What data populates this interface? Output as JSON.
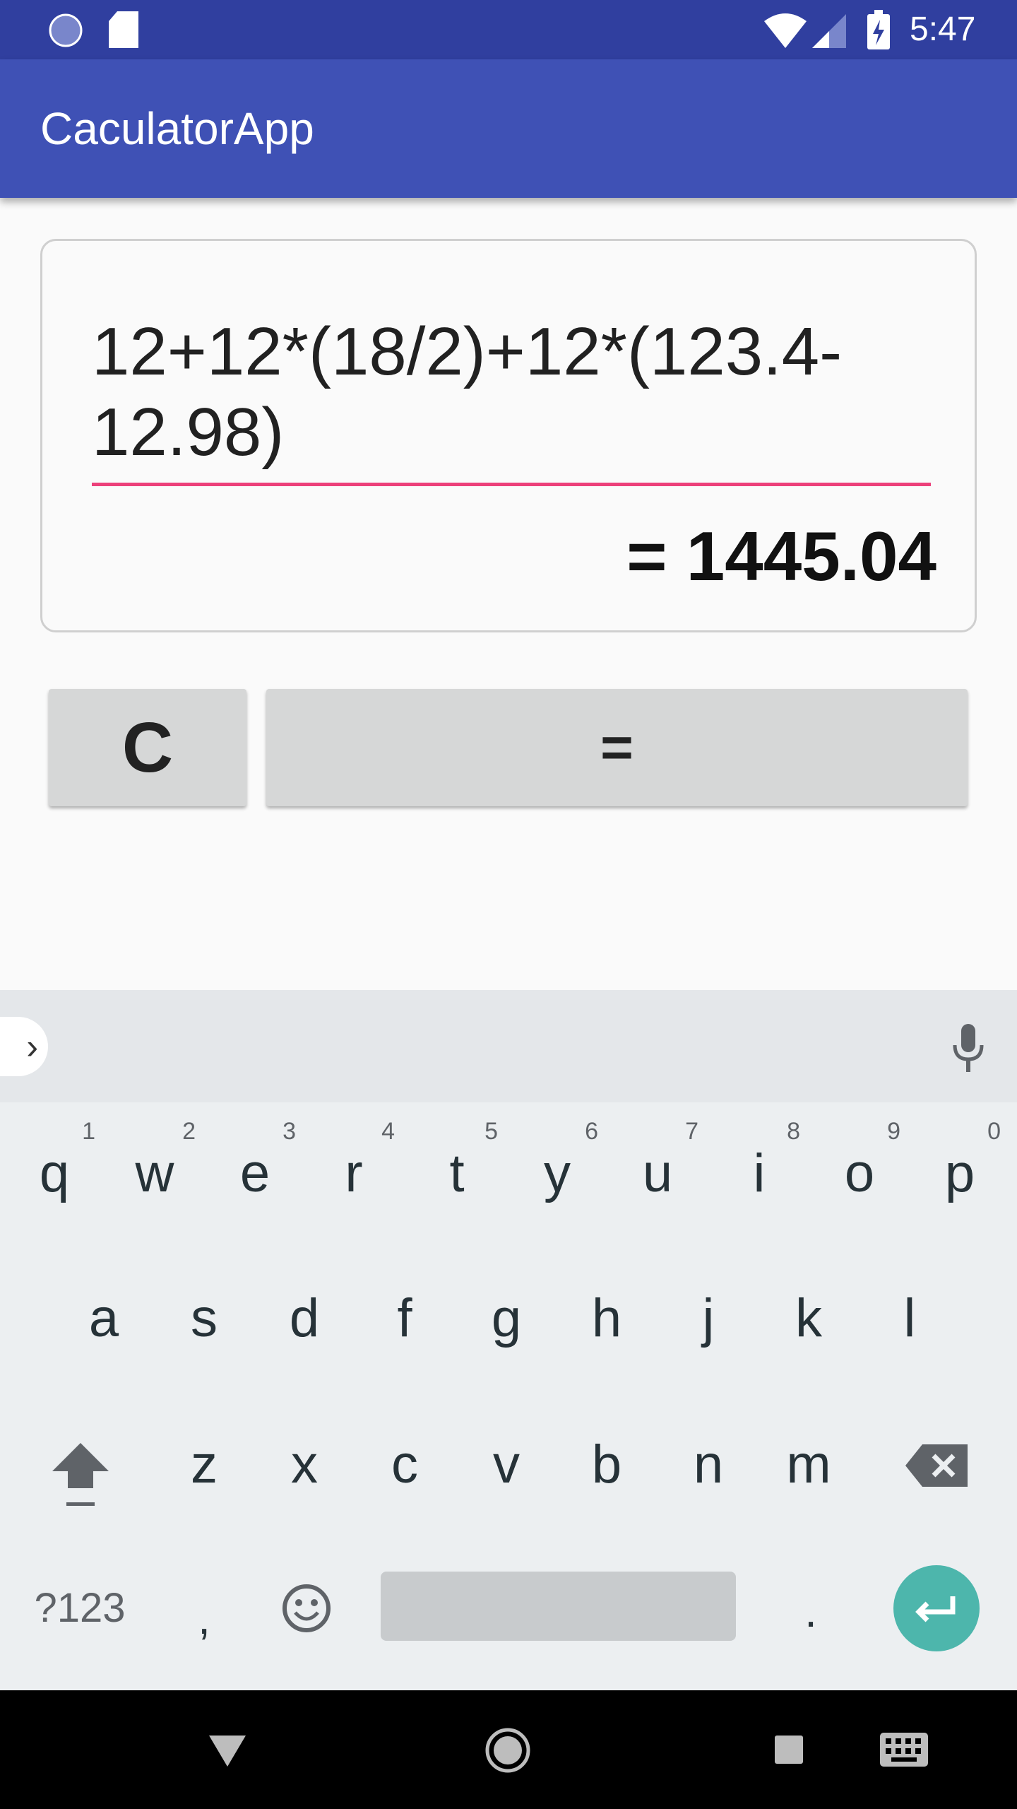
{
  "status_bar": {
    "time": "5:47",
    "icons": [
      "sync-icon",
      "sd-card-icon",
      "wifi-icon",
      "signal-icon",
      "battery-charging-icon"
    ]
  },
  "app_bar": {
    "title": "CaculatorApp"
  },
  "calculator": {
    "expression": "12+12*(18/2)+12*(123.4-12.98)",
    "result": "= 1445.04",
    "clear_label": "C",
    "equals_label": "=",
    "accent": "#ec407a"
  },
  "keyboard": {
    "row1": [
      {
        "k": "q",
        "n": "1"
      },
      {
        "k": "w",
        "n": "2"
      },
      {
        "k": "e",
        "n": "3"
      },
      {
        "k": "r",
        "n": "4"
      },
      {
        "k": "t",
        "n": "5"
      },
      {
        "k": "y",
        "n": "6"
      },
      {
        "k": "u",
        "n": "7"
      },
      {
        "k": "i",
        "n": "8"
      },
      {
        "k": "o",
        "n": "9"
      },
      {
        "k": "p",
        "n": "0"
      }
    ],
    "row2": [
      "a",
      "s",
      "d",
      "f",
      "g",
      "h",
      "j",
      "k",
      "l"
    ],
    "row3": [
      "z",
      "x",
      "c",
      "v",
      "b",
      "n",
      "m"
    ],
    "symbols_label": "?123",
    "comma": ",",
    "period": ".",
    "enter_color": "#4db6ac"
  }
}
